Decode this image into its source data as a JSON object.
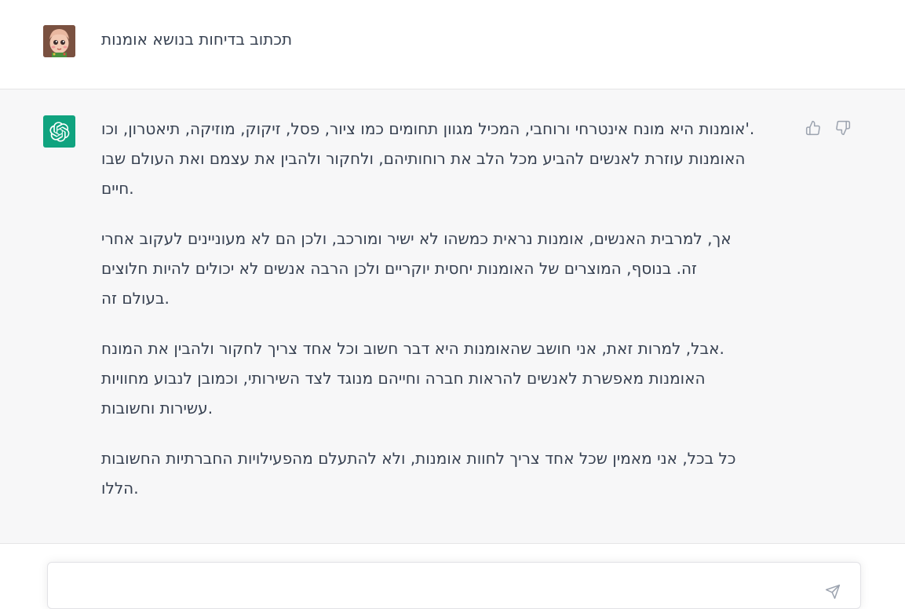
{
  "user_message": {
    "text": "תכתוב בדיחות בנושא אומנות"
  },
  "assistant_message": {
    "paragraphs": [
      {
        "lines": [
          "אומנות היא מונח אינטרחי ורוחבי, המכיל מגוון תחומים כמו ציור, פסל, זיקוק, מוזיקה, תיאטרון, וכו'.",
          "האומנות עוזרת לאנשים להביע מכל הלב את רוחותיהם, ולחקור ולהבין את עצמם ואת העולם שבו",
          "חיים."
        ]
      },
      {
        "lines": [
          "אך, למרבית האנשים, אומנות נראית כמשהו לא ישיר ומורכב, ולכן הם לא מעוניינים לעקוב אחרי",
          "זה. בנוסף, המוצרים של האומנות יחסית יוקריים ולכן הרבה אנשים לא יכולים להיות חלוצים",
          "בעולם זה."
        ]
      },
      {
        "lines": [
          "אבל, למרות זאת, אני חושב שהאומנות היא דבר חשוב וכל אחד צריך לחקור ולהבין את המונח.",
          "האומנות מאפשרת לאנשים להראות חברה וחייהם מנוגד לצד השירותי, וכמובן לנבוע מחוויות",
          "עשירות וחשובות."
        ]
      },
      {
        "lines": [
          "כל בכל, אני מאמין שכל אחד צריך לחוות אומנות, ולא להתעלם מהפעילויות החברתיות החשובות",
          "הללו."
        ]
      }
    ]
  },
  "icons": {
    "user_avatar": "user-avatar",
    "assistant_avatar": "openai-logo-icon",
    "thumbs_up": "thumbs-up-icon",
    "thumbs_down": "thumbs-down-icon",
    "send": "send-icon"
  },
  "colors": {
    "assistant_bg": "#f7f7f8",
    "assistant_avatar_bg": "#10a37f",
    "text": "#374151"
  }
}
